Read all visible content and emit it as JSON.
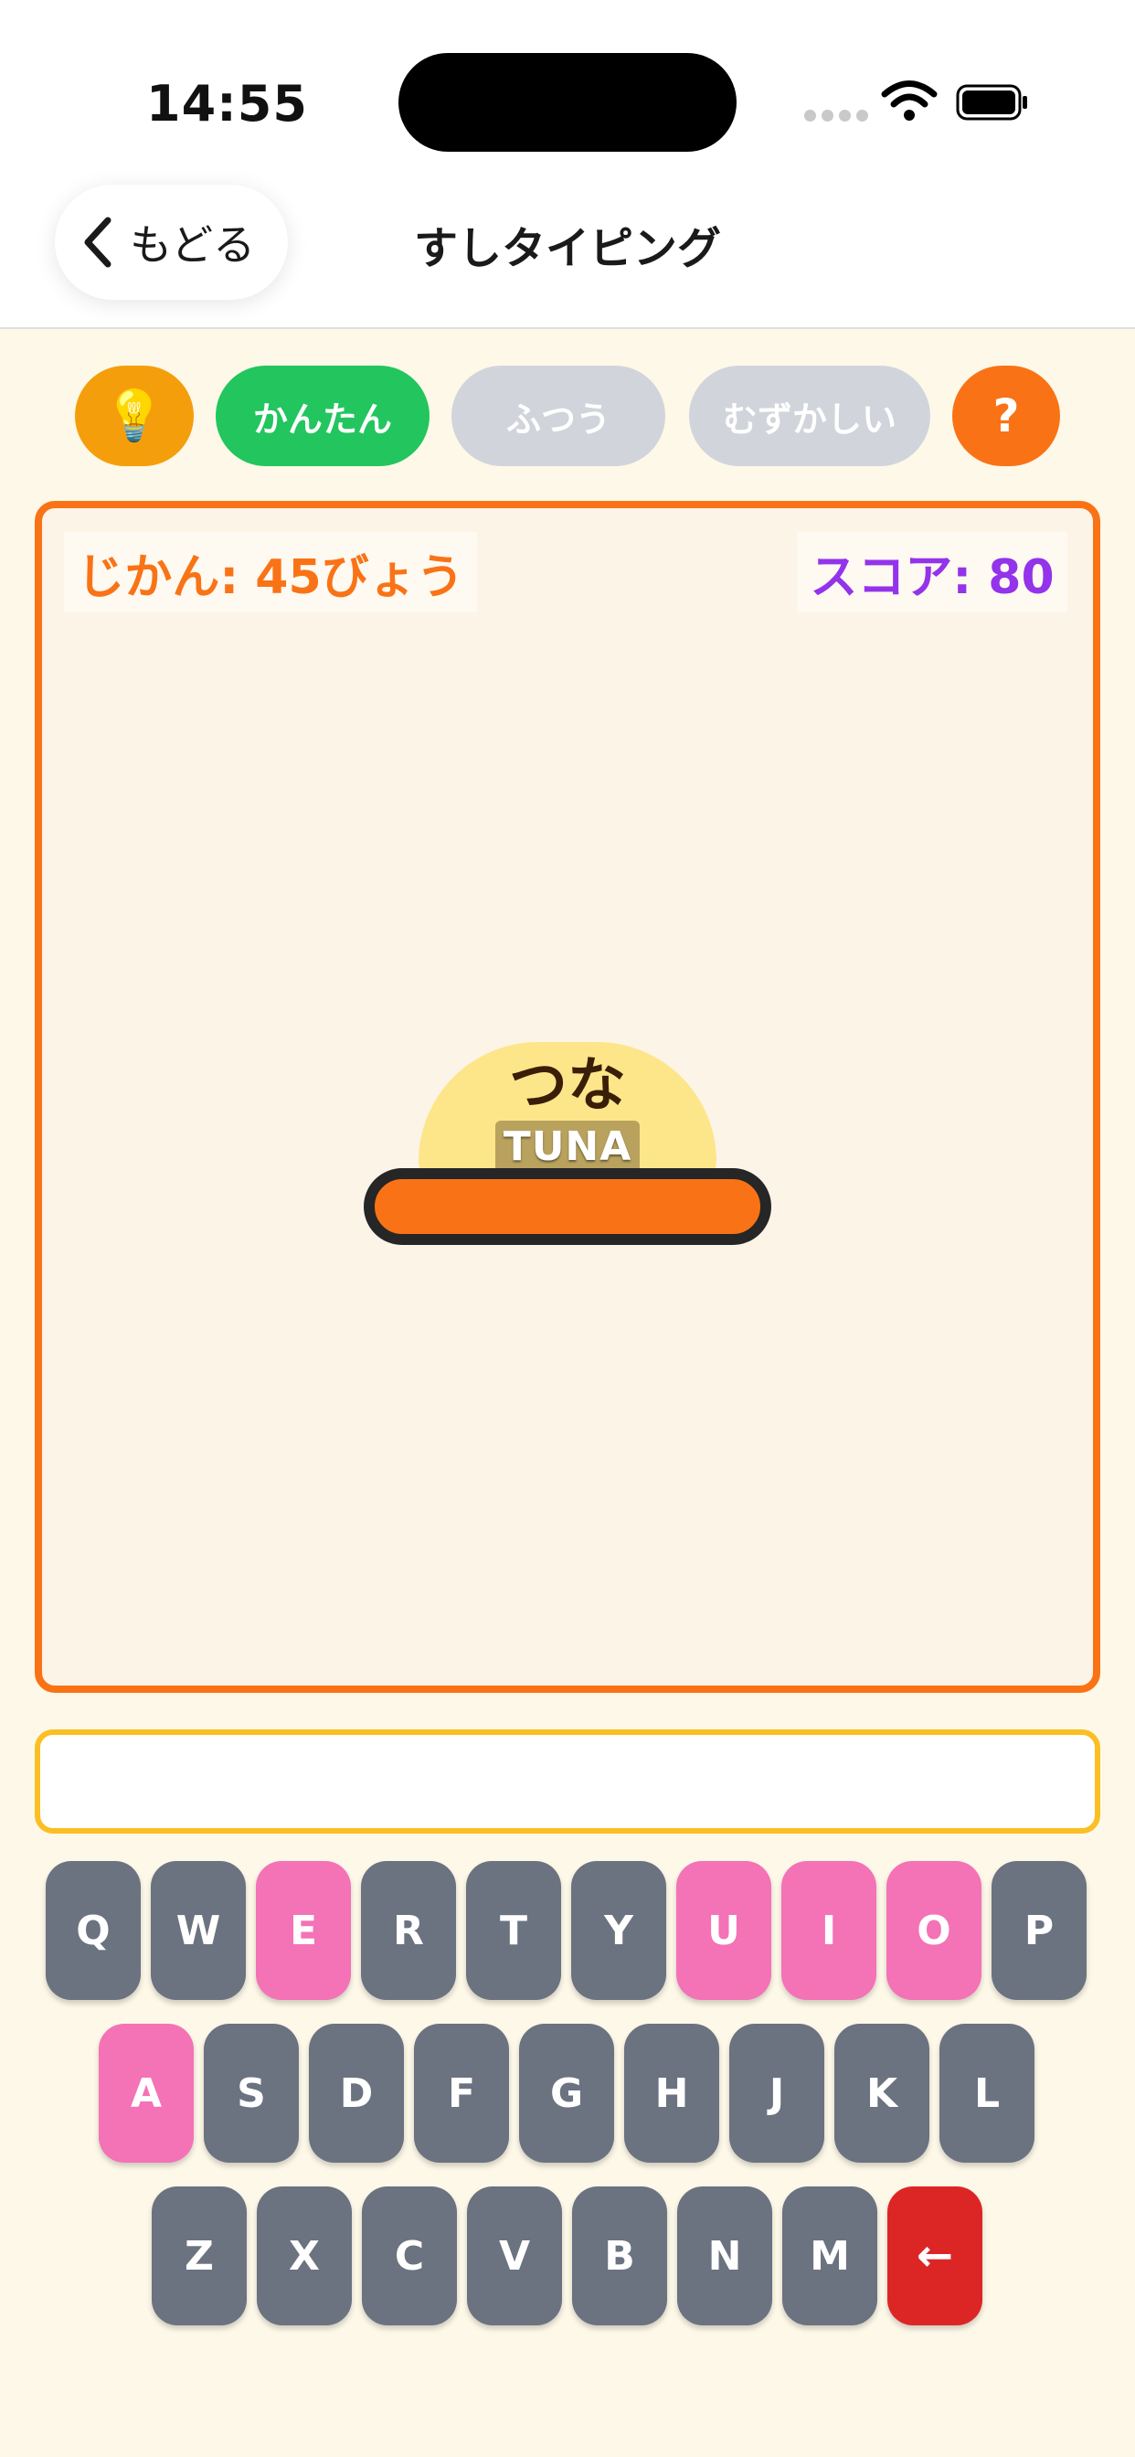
{
  "status_bar": {
    "time": "14:55"
  },
  "nav": {
    "back_label": "もどる",
    "title": "すしタイピング"
  },
  "toolbar": {
    "hint_icon": "lightbulb-icon",
    "hint_glyph": "💡",
    "difficulty": {
      "easy": "かんたん",
      "normal": "ふつう",
      "hard": "むずかしい",
      "selected": "かんたん"
    },
    "help_label": "?"
  },
  "game": {
    "time_label": "じかん: 45びょう",
    "score_label": "スコア: 80",
    "sushi": {
      "kana": "つな",
      "romaji": "TUNA"
    }
  },
  "answer_input": {
    "value": ""
  },
  "keyboard": {
    "row1": [
      "Q",
      "W",
      "E",
      "R",
      "T",
      "Y",
      "U",
      "I",
      "O",
      "P"
    ],
    "row2": [
      "A",
      "S",
      "D",
      "F",
      "G",
      "H",
      "J",
      "K",
      "L"
    ],
    "row3": [
      "Z",
      "X",
      "C",
      "V",
      "B",
      "N",
      "M"
    ],
    "backspace": "←",
    "highlighted_keys": [
      "E",
      "U",
      "I",
      "O",
      "A"
    ]
  },
  "colors": {
    "accent_orange": "#f97316",
    "score_purple": "#9333ea",
    "easy_green": "#22c55e",
    "key_gray": "#6b7280",
    "key_pink": "#f472b6",
    "backspace_red": "#dc2626"
  }
}
